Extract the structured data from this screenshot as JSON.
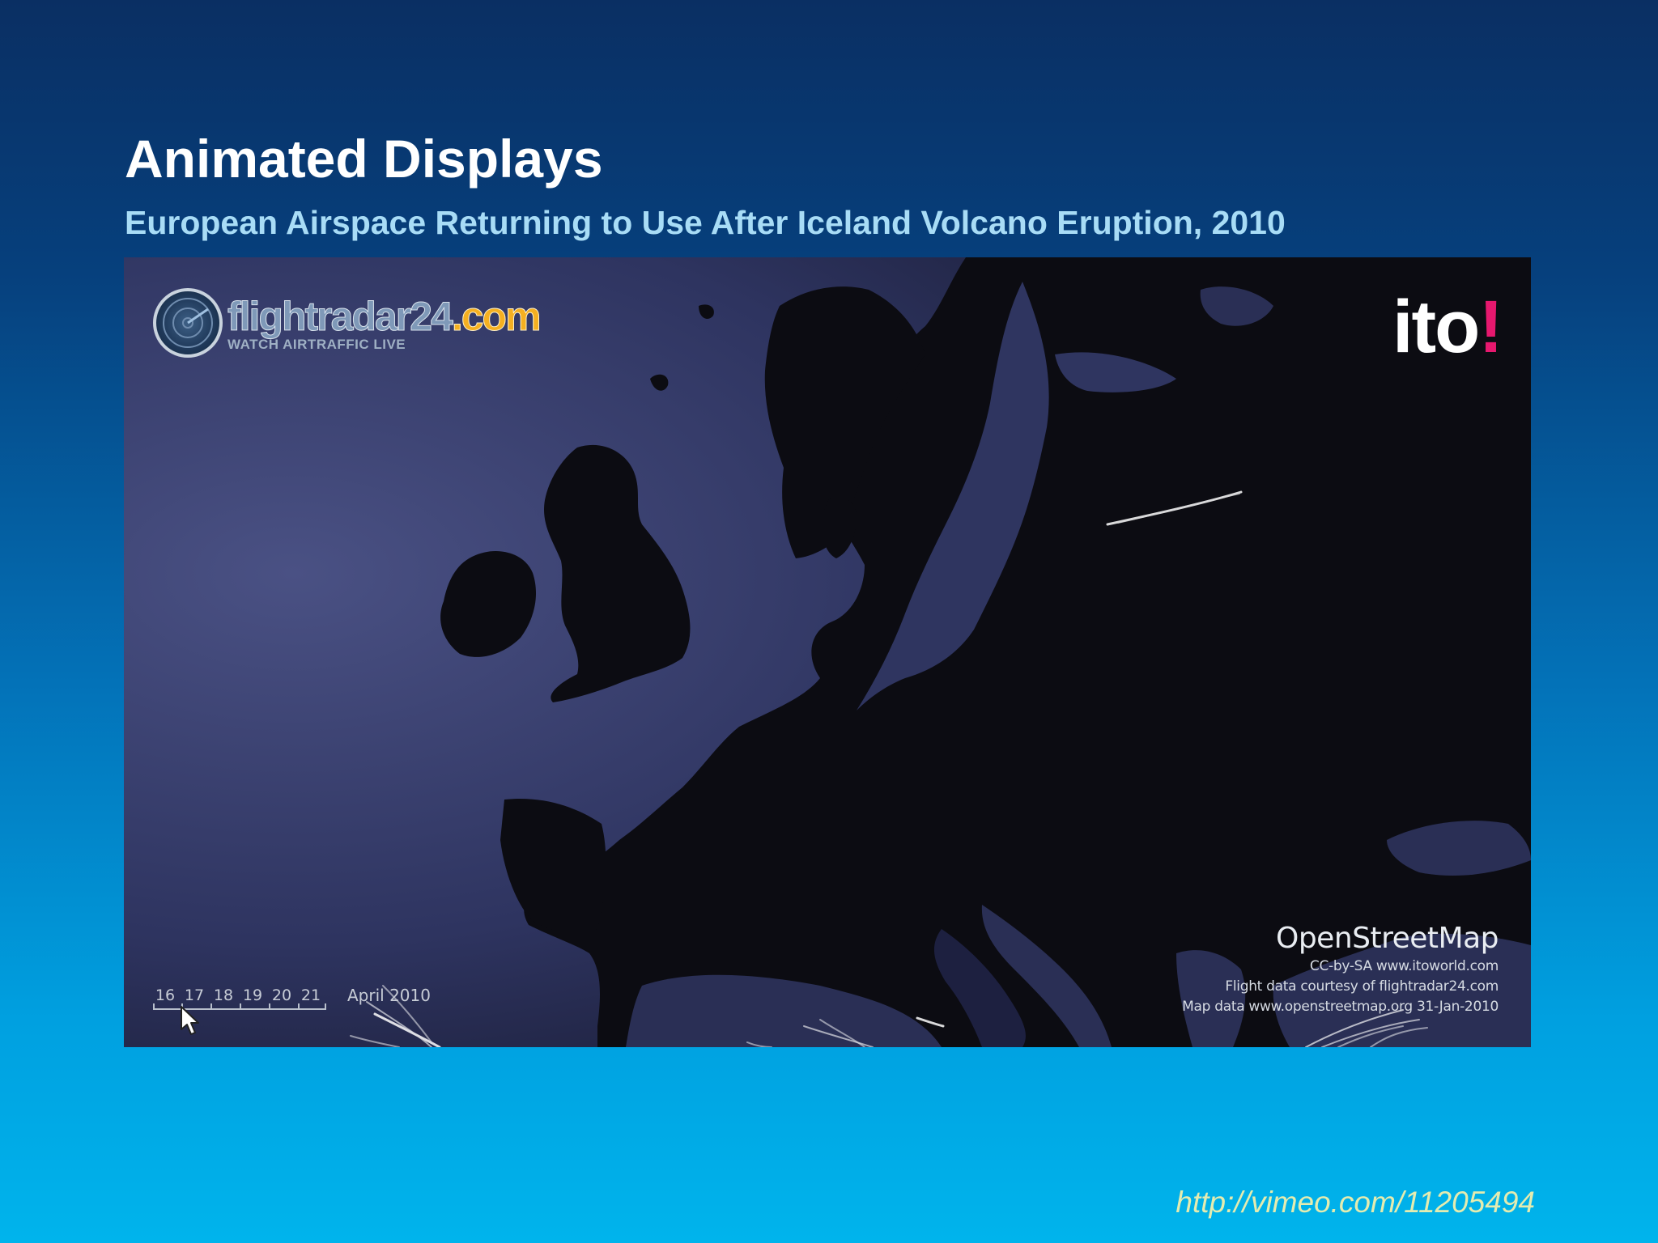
{
  "slide": {
    "title": "Animated Displays",
    "subtitle": "European Airspace Returning to Use After Iceland Volcano Eruption, 2010",
    "source_link": "http://vimeo.com/11205494"
  },
  "video": {
    "flightradar_logo": {
      "wordmark_main": "flightradar24",
      "wordmark_suffix": ".com",
      "tagline": "WATCH AIRTRAFFIC LIVE"
    },
    "ito_logo": {
      "text": "ito",
      "accent": "!"
    },
    "timeline": {
      "days": [
        "16",
        "17",
        "18",
        "19",
        "20",
        "21"
      ],
      "month": "April 2010"
    },
    "attribution": {
      "title": "OpenStreetMap",
      "lines": [
        "CC-by-SA www.itoworld.com",
        "Flight data courtesy of flightradar24.com",
        "Map data www.openstreetmap.org 31-Jan-2010"
      ]
    }
  },
  "colors": {
    "title": "#ffffff",
    "subtitle": "#a8dcf6",
    "link": "#e4ecb0",
    "sea": "#3c4270",
    "land": "#0c0c12",
    "flight_trails": "#ffffff"
  }
}
